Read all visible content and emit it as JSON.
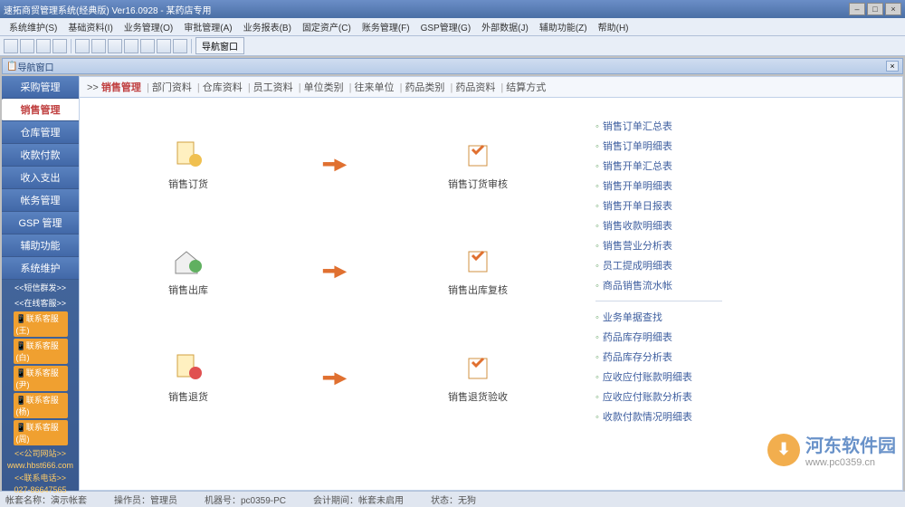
{
  "titlebar": {
    "text": "速拓商贸管理系统(经典版) Ver16.0928 - 某药店专用"
  },
  "menubar": {
    "items": [
      "系统维护(S)",
      "基础资料(I)",
      "业务管理(O)",
      "审批管理(A)",
      "业务报表(B)",
      "固定资产(C)",
      "账务管理(F)",
      "GSP管理(G)",
      "外部数据(J)",
      "辅助功能(Z)",
      "帮助(H)"
    ]
  },
  "toolbar": {
    "nav_button": "导航窗口"
  },
  "subwindow": {
    "title": "导航窗口"
  },
  "sidebar": {
    "items": [
      {
        "label": "采购管理",
        "active": false
      },
      {
        "label": "销售管理",
        "active": true
      },
      {
        "label": "仓库管理",
        "active": false
      },
      {
        "label": "收款付款",
        "active": false
      },
      {
        "label": "收入支出",
        "active": false
      },
      {
        "label": "帐务管理",
        "active": false
      },
      {
        "label": "GSP 管理",
        "active": false
      },
      {
        "label": "辅助功能",
        "active": false
      },
      {
        "label": "系统维护",
        "active": false
      }
    ],
    "info_lines": [
      "<<短信群发>>",
      "<<在线客服>>"
    ],
    "badges": [
      "📱联系客服(王)",
      "📱联系客服(白)",
      "📱联系客服(尹)",
      "📱联系客服(杨)",
      "📱联系客服(周)"
    ],
    "links": [
      "<<公司网站>>",
      "www.hbst666.com",
      "<<联系电话>>",
      "027-86647565"
    ]
  },
  "content": {
    "tabs": {
      "active": "销售管理",
      "items": [
        "部门资料",
        "仓库资料",
        "员工资料",
        "单位类别",
        "往来单位",
        "药品类别",
        "药品资料",
        "结算方式"
      ]
    },
    "workflow": [
      {
        "left": "销售订货",
        "right": "销售订货审核"
      },
      {
        "left": "销售出库",
        "right": "销售出库复核"
      },
      {
        "left": "销售退货",
        "right": "销售退货验收"
      }
    ]
  },
  "right_panel": {
    "group1": [
      "销售订单汇总表",
      "销售订单明细表",
      "销售开单汇总表",
      "销售开单明细表",
      "销售开单日报表",
      "销售收款明细表",
      "销售营业分析表",
      "员工提成明细表",
      "商品销售流水帐"
    ],
    "group2": [
      "业务单据查找",
      "药品库存明细表",
      "药品库存分析表",
      "应收应付账款明细表",
      "应收应付账款分析表",
      "收款付款情况明细表"
    ]
  },
  "statusbar": {
    "segments": [
      {
        "label": "帐套名称：",
        "value": "演示帐套"
      },
      {
        "label": "操作员：",
        "value": "管理员"
      },
      {
        "label": "机器号：",
        "value": "pc0359-PC"
      },
      {
        "label": "会计期间：",
        "value": "帐套未启用"
      },
      {
        "label": "状态：",
        "value": "无狗"
      }
    ]
  },
  "watermark": {
    "name": "河东软件园",
    "url": "www.pc0359.cn"
  }
}
